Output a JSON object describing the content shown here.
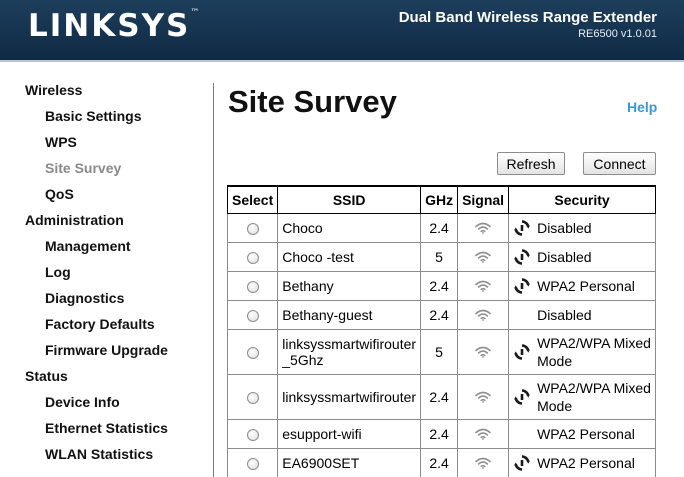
{
  "header": {
    "logo": "LINKSYS",
    "trademark": "™",
    "product_name": "Dual Band Wireless Range Extender",
    "model": "RE6500 v1.0.01"
  },
  "sidebar": {
    "sections": [
      {
        "label": "Wireless",
        "items": [
          "Basic Settings",
          "WPS",
          "Site Survey",
          "QoS"
        ]
      },
      {
        "label": "Administration",
        "items": [
          "Management",
          "Log",
          "Diagnostics",
          "Factory Defaults",
          "Firmware Upgrade"
        ]
      },
      {
        "label": "Status",
        "items": [
          "Device Info",
          "Ethernet Statistics",
          "WLAN Statistics"
        ]
      }
    ],
    "active_item": "Site Survey"
  },
  "main": {
    "title": "Site Survey",
    "help_label": "Help",
    "refresh_label": "Refresh",
    "connect_label": "Connect",
    "columns": [
      "Select",
      "SSID",
      "GHz",
      "Signal",
      "Security"
    ],
    "rows": [
      {
        "ssid": "Choco",
        "ghz": "2.4",
        "security": "Disabled",
        "security_icon": "refresh-arrows-icon"
      },
      {
        "ssid": "Choco -test",
        "ghz": "5",
        "security": "Disabled",
        "security_icon": "refresh-arrows-icon"
      },
      {
        "ssid": "Bethany",
        "ghz": "2.4",
        "security": "WPA2 Personal",
        "security_icon": "refresh-arrows-icon"
      },
      {
        "ssid": "Bethany-guest",
        "ghz": "2.4",
        "security": "Disabled",
        "security_icon": ""
      },
      {
        "ssid": "linksyssmartwifirouter _5Ghz",
        "ghz": "5",
        "security": "WPA2/WPA Mixed Mode",
        "security_icon": "refresh-arrows-icon"
      },
      {
        "ssid": "linksyssmartwifirouter",
        "ghz": "2.4",
        "security": "WPA2/WPA Mixed Mode",
        "security_icon": "refresh-arrows-icon"
      },
      {
        "ssid": "esupport-wifi",
        "ghz": "2.4",
        "security": "WPA2 Personal",
        "security_icon": ""
      },
      {
        "ssid": "EA6900SET",
        "ghz": "2.4",
        "security": "WPA2 Personal",
        "security_icon": "refresh-arrows-icon"
      }
    ],
    "signal_icon": "wifi-signal-icon"
  },
  "colors": {
    "header_bg": "#0f2a44",
    "help_link": "#3b9ad5",
    "active_nav": "#8a8a8a"
  }
}
